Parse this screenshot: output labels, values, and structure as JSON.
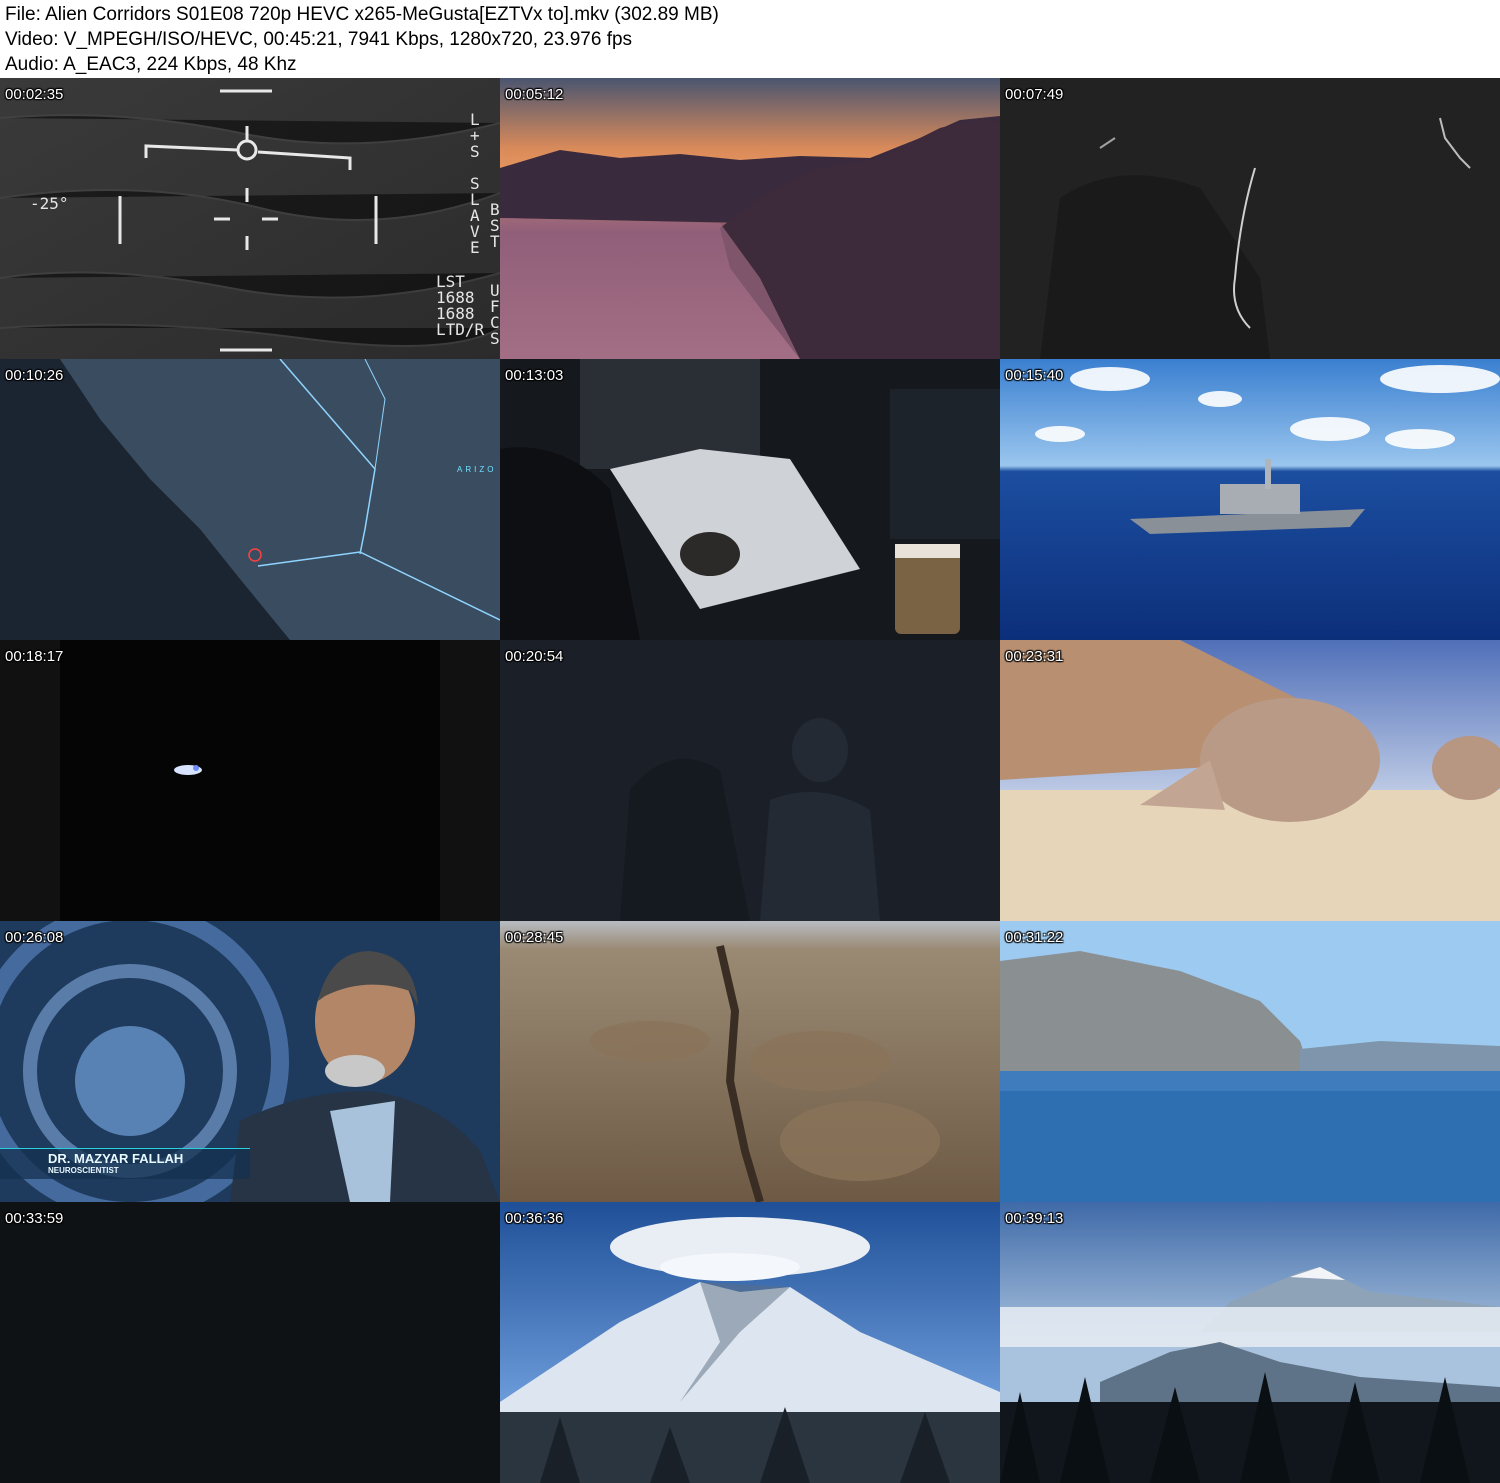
{
  "header": {
    "file_line": "File: Alien Corridors S01E08 720p HEVC x265-MeGusta[EZTVx to].mkv (302.89 MB)",
    "video_line": "Video: V_MPEGH/ISO/HEVC, 00:45:21, 7941 Kbps, 1280x720, 23.976 fps",
    "audio_line": "Audio: A_EAC3, 224 Kbps, 48 Khz"
  },
  "thumbnails": [
    {
      "timestamp": "00:02:35",
      "hud_angle": "-25°",
      "hud_right": "L\n+\nS\n\nS\nL\nA\nV\nE",
      "hud_right2": "B\nS\nT",
      "hud_bottom": "LST\n1688\n1688\nLTD/R",
      "hud_bottom2": "U\nF\nC\nS"
    },
    {
      "timestamp": "00:05:12"
    },
    {
      "timestamp": "00:07:49"
    },
    {
      "timestamp": "00:10:26",
      "map_label": "ARIZO"
    },
    {
      "timestamp": "00:13:03"
    },
    {
      "timestamp": "00:15:40"
    },
    {
      "timestamp": "00:18:17"
    },
    {
      "timestamp": "00:20:54"
    },
    {
      "timestamp": "00:23:31"
    },
    {
      "timestamp": "00:26:08",
      "caption_name": "DR. MAZYAR FALLAH",
      "caption_role": "NEUROSCIENTIST"
    },
    {
      "timestamp": "00:28:45"
    },
    {
      "timestamp": "00:31:22"
    },
    {
      "timestamp": "00:33:59"
    },
    {
      "timestamp": "00:36:36"
    },
    {
      "timestamp": "00:39:13"
    }
  ]
}
